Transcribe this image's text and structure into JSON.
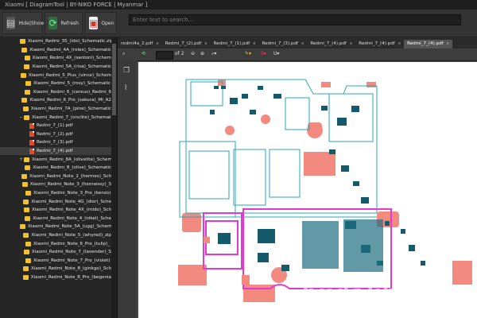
{
  "window": {
    "title": "Xiaomi [ DiagramTool | BY-NIKO FORCE | Myanmar ]"
  },
  "toolbar": {
    "hideshow_label": "Hide|Show",
    "refresh_label": "Refresh",
    "open_label": "Open",
    "search_placeholder": "Enter text to search..."
  },
  "tree": {
    "items": [
      {
        "label": "Xiaomi_Redmi_3S_(ido)_Schematic.zip",
        "type": "folder",
        "expander": ""
      },
      {
        "label": "Xiaomi_Redmi_4A_(rolex)_Schematic",
        "type": "folder",
        "expander": ""
      },
      {
        "label": "Xiaomi_Redmi_4X_(santoni)_Schem",
        "type": "folder",
        "expander": ""
      },
      {
        "label": "Xiaomi_Redmi_5A_(riva)_Schematic",
        "type": "folder",
        "expander": ""
      },
      {
        "label": "Xiaomi_Redmi_5_Plus_(vince)_Schem",
        "type": "folder",
        "expander": ""
      },
      {
        "label": "Xiaomi_Redmi_5_(rosy)_Schematic",
        "type": "folder",
        "expander": ""
      },
      {
        "label": "Xiaomi_Redmi_6_(cereus)_Redmi_6",
        "type": "folder",
        "expander": ""
      },
      {
        "label": "Xiaomi_Redmi_6_Pro_(sakura)_Mi_A2",
        "type": "folder",
        "expander": ""
      },
      {
        "label": "Xiaomi_Redmi_7A_(pine)_Schematic",
        "type": "folder",
        "expander": ""
      },
      {
        "label": "Xiaomi_Redmi_7_(onclite)_Schematic",
        "type": "folder",
        "expander": "−"
      },
      {
        "label": "Redmi_7_(1).pdf",
        "type": "pdf",
        "child": true
      },
      {
        "label": "Redmi_7_(2).pdf",
        "type": "pdf",
        "child": true
      },
      {
        "label": "Redmi_7_(3).pdf",
        "type": "pdf",
        "child": true
      },
      {
        "label": "Redmi_7_(4).pdf",
        "type": "pdf",
        "child": true,
        "selected": true
      },
      {
        "label": "Xiaomi_Redmi_8A_(olivelite)_Schem",
        "type": "folder",
        "expander": "+"
      },
      {
        "label": "Xiaomi_Redmi_8_(olive)_Schematic",
        "type": "folder",
        "expander": ""
      },
      {
        "label": "Xiaomi_Redmi_Note_2_(hermes)_Sch",
        "type": "folder",
        "expander": ""
      },
      {
        "label": "Xiaomi_Redmi_Note_3_(hennessy)_S",
        "type": "folder",
        "expander": ""
      },
      {
        "label": "Xiaomi_Redmi_Note_3_Pro_(kenzo)",
        "type": "folder",
        "expander": ""
      },
      {
        "label": "Xiaomi_Redmi_Note_4G_(dior)_Sche",
        "type": "folder",
        "expander": ""
      },
      {
        "label": "Xiaomi_Redmi_Note_4X_(mido)_Sch",
        "type": "folder",
        "expander": ""
      },
      {
        "label": "Xiaomi_Redmi_Note_4_(nikel)_Sche",
        "type": "folder",
        "expander": ""
      },
      {
        "label": "Xiaomi_Redmi_Note_5A_(ugg)_Schem",
        "type": "folder",
        "expander": ""
      },
      {
        "label": "Xiaomi_Redmi_Note_5_(whyred)_zip",
        "type": "folder",
        "expander": ""
      },
      {
        "label": "Xiaomi_Redmi_Note_6_Pro_(tulip)_",
        "type": "folder",
        "expander": ""
      },
      {
        "label": "Xiaomi_Redmi_Note_7_(lavender)_S",
        "type": "folder",
        "expander": ""
      },
      {
        "label": "Xiaomi_Redmi_Note_7_Pro_(violet)",
        "type": "folder",
        "expander": ""
      },
      {
        "label": "Xiaomi_Redmi_Note_8_(ginkgo)_Sch",
        "type": "folder",
        "expander": ""
      },
      {
        "label": "Xiaomi_Redmi_Note_8_Pro_(begonia",
        "type": "folder",
        "expander": ""
      }
    ]
  },
  "tabs": [
    {
      "label": "redmi4a_2.pdf",
      "active": false
    },
    {
      "label": "Redmi_7_(2).pdf",
      "active": false
    },
    {
      "label": "Redmi_7_(1).pdf",
      "active": false
    },
    {
      "label": "Redmi_7_(3).pdf",
      "active": false
    },
    {
      "label": "Redmi_7_(4).pdf",
      "active": false
    },
    {
      "label": "Redmi_7_(4).pdf",
      "active": false
    },
    {
      "label": "Redmi_7_(4).pdf",
      "active": true
    }
  ],
  "tab_close": "x",
  "pdf_toolbar": {
    "page_of": "of 2"
  },
  "watermark": "budakbego",
  "colors": {
    "board_cyan": "#2aa7b8",
    "board_magenta": "#e23ad0",
    "board_red": "#f28a80",
    "folder": "#f2c12e"
  }
}
